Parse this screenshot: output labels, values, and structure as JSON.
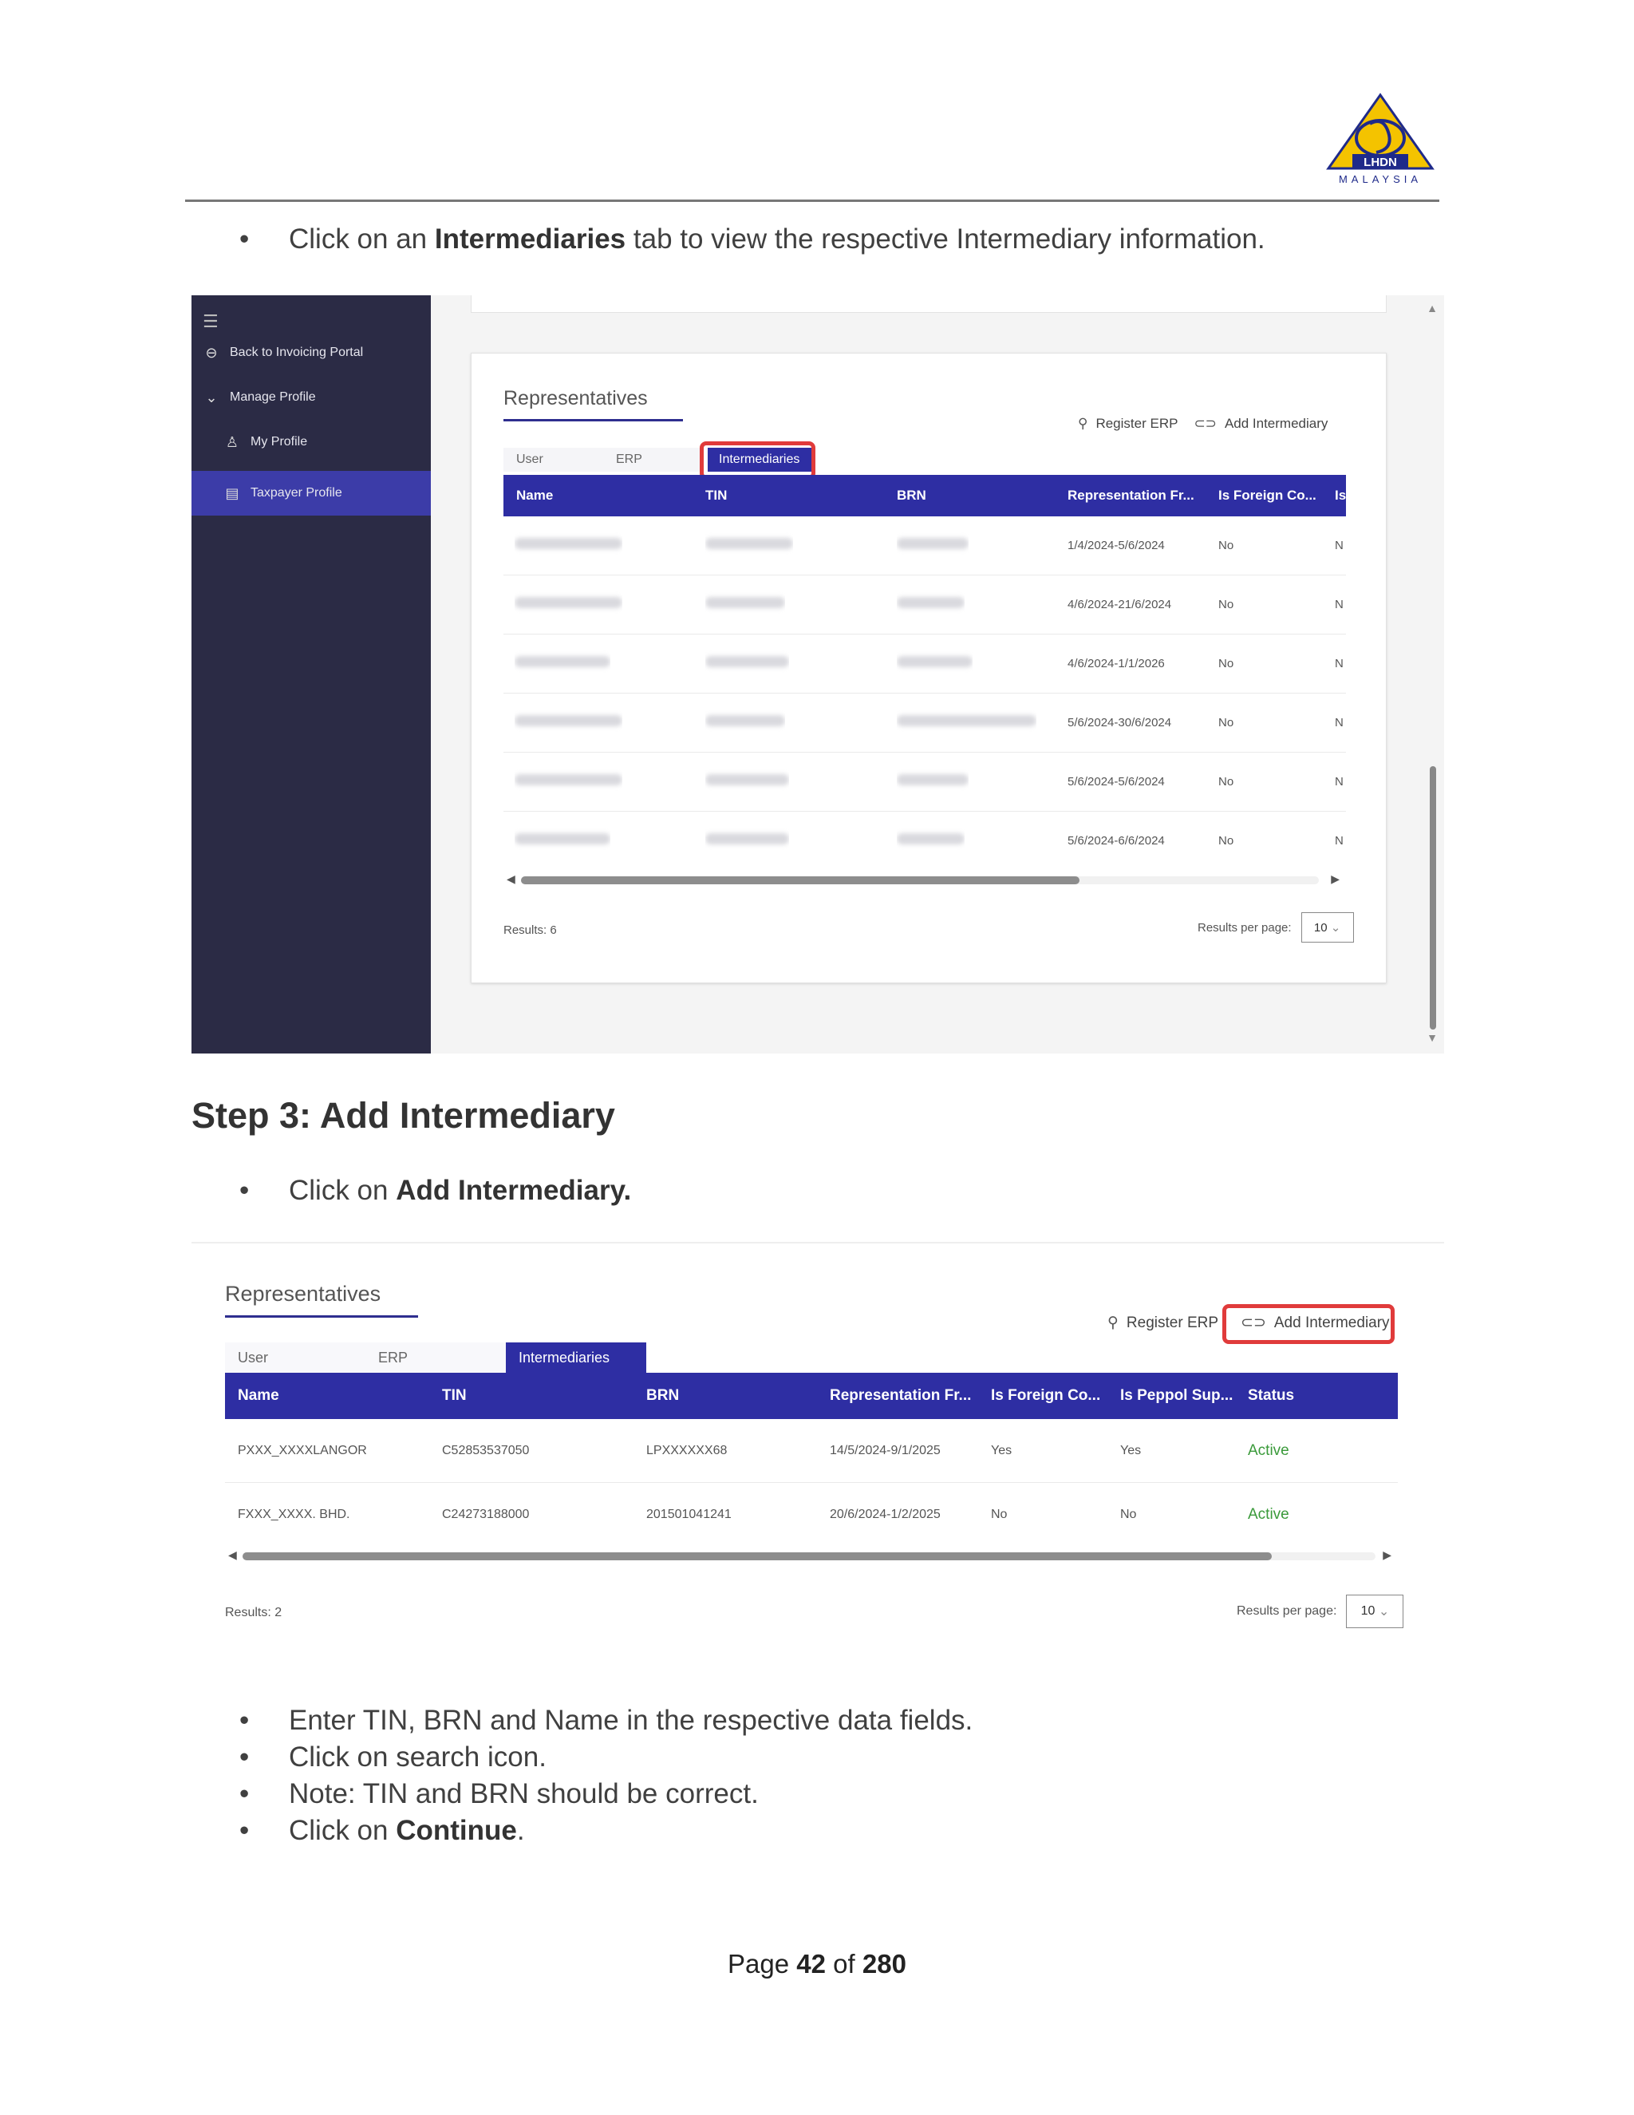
{
  "header": {
    "logo_text": "LHDN",
    "logo_subtext": "MALAYSIA"
  },
  "intro_bullet": {
    "prefix": "Click on an ",
    "bold": "Intermediaries",
    "suffix": " tab to view the respective Intermediary information."
  },
  "shot1": {
    "sidebar": {
      "menu_icon": "hamburger-icon",
      "items": [
        {
          "label": "Back to Invoicing Portal",
          "icon": "back-circle-icon"
        },
        {
          "label": "Manage Profile",
          "icon": "chevron-down-icon"
        },
        {
          "label": "My Profile",
          "icon": "person-icon"
        },
        {
          "label": "Taxpayer Profile",
          "icon": "document-icon",
          "active": true
        }
      ]
    },
    "card": {
      "title": "Representatives",
      "actions": {
        "register_erp": "Register ERP",
        "add_intermediary": "Add Intermediary"
      },
      "tabs": [
        "User",
        "ERP",
        "Intermediaries"
      ],
      "active_tab": "Intermediaries",
      "columns": [
        "Name",
        "TIN",
        "BRN",
        "Representation Fr...",
        "Is Foreign Co...",
        "Is"
      ],
      "rows": [
        {
          "period": "1/4/2024-5/6/2024",
          "foreign": "No",
          "last": "N"
        },
        {
          "period": "4/6/2024-21/6/2024",
          "foreign": "No",
          "last": "N"
        },
        {
          "period": "4/6/2024-1/1/2026",
          "foreign": "No",
          "last": "N"
        },
        {
          "period": "5/6/2024-30/6/2024",
          "foreign": "No",
          "last": "N"
        },
        {
          "period": "5/6/2024-5/6/2024",
          "foreign": "No",
          "last": "N"
        },
        {
          "period": "5/6/2024-6/6/2024",
          "foreign": "No",
          "last": "N"
        }
      ],
      "results": "Results: 6",
      "results_per_page_label": "Results per page:",
      "results_per_page_value": "10"
    }
  },
  "step_heading": "Step 3: Add Intermediary",
  "step_bullet": {
    "prefix": "Click on ",
    "bold": "Add Intermediary."
  },
  "shot2": {
    "title": "Representatives",
    "actions": {
      "register_erp": "Register ERP",
      "add_intermediary": "Add Intermediary"
    },
    "tabs": [
      "User",
      "ERP",
      "Intermediaries"
    ],
    "columns": [
      "Name",
      "TIN",
      "BRN",
      "Representation Fr...",
      "Is Foreign Co...",
      "Is Peppol Sup...",
      "Status"
    ],
    "rows": [
      [
        "PXXX_XXXXLANGOR",
        "C52853537050",
        "LPXXXXXX68",
        "14/5/2024-9/1/2025",
        "Yes",
        "Yes",
        "Active"
      ],
      [
        "FXXX_XXXX. BHD.",
        "C24273188000",
        "201501041241",
        "20/6/2024-1/2/2025",
        "No",
        "No",
        "Active"
      ]
    ],
    "results": "Results: 2",
    "results_per_page_label": "Results per page:",
    "results_per_page_value": "10"
  },
  "instructions": [
    {
      "text": "Enter TIN, BRN and Name in the respective data fields."
    },
    {
      "text": "Click on search icon."
    },
    {
      "text": "Note: TIN and BRN should be correct."
    },
    {
      "prefix": "Click on ",
      "bold": "Continue",
      "suffix": "."
    }
  ],
  "footer": {
    "page_prefix": "Page ",
    "page": "42",
    "of": " of ",
    "total": "280"
  }
}
